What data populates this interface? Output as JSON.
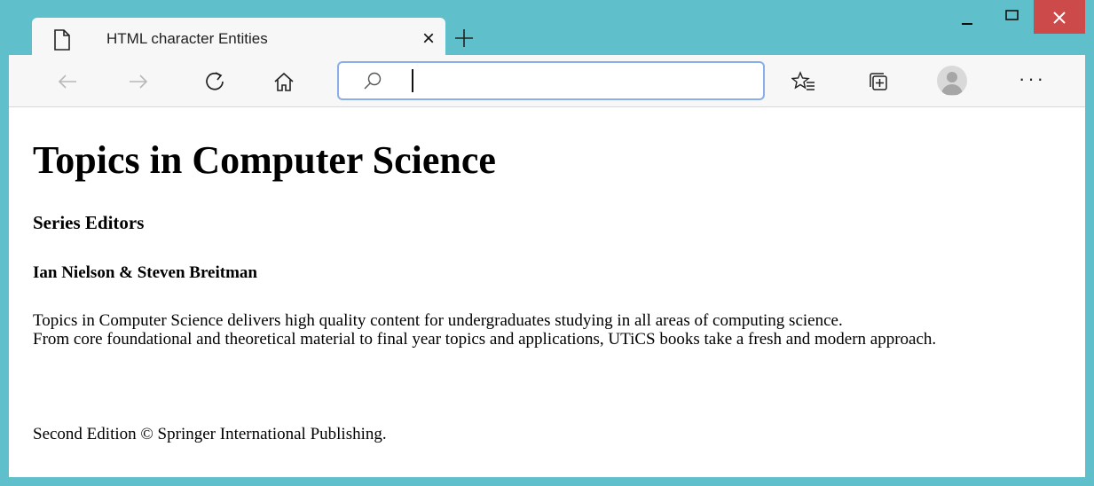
{
  "tab": {
    "title": "HTML character Entities",
    "close_label": "×"
  },
  "toolbar": {
    "address_value": "",
    "more_label": "···"
  },
  "icons": {
    "page": "page-icon",
    "close": "close-icon",
    "new_tab": "plus-icon",
    "back": "back-arrow-icon",
    "forward": "forward-arrow-icon",
    "refresh": "refresh-icon",
    "home": "home-icon",
    "search": "search-icon",
    "favorites": "favorites-icon",
    "collections": "collections-icon",
    "profile": "profile-icon",
    "more": "more-icon",
    "minimize": "minimize-icon",
    "maximize": "maximize-icon",
    "window_close": "window-close-icon"
  },
  "colors": {
    "frame": "#5fc0cb",
    "close_button": "#cc4a4a",
    "address_border": "#8aaee8"
  },
  "page": {
    "title": "Topics in Computer Science",
    "series_heading": "Series Editors",
    "editors": "Ian Nielson & Steven Breitman",
    "description_line1": "Topics in Computer Science delivers high quality content for undergraduates studying in all areas of computing science.",
    "description_line2": "From core foundational and theoretical material to final year topics and applications, UTiCS books take a fresh and modern approach.",
    "edition": "Second Edition © Springer International Publishing."
  }
}
